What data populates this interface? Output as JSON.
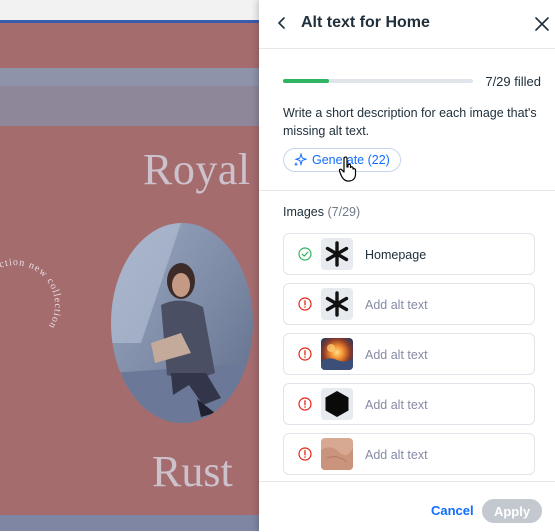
{
  "background": {
    "headline_top": "Royal",
    "headline_bottom": "Rust",
    "circle_text": "new collection new collection"
  },
  "panel": {
    "title": "Alt text for Home",
    "progress": {
      "filled": 7,
      "total": 29,
      "label": "7/29 filled"
    },
    "description": "Write a short description for each image that's missing alt text.",
    "generate_label": "Generate (22)",
    "images_heading": "Images",
    "images_count": "(7/29)",
    "images": [
      {
        "text": "Homepage",
        "status": "done",
        "thumb": "asterisk"
      },
      {
        "text": "Add alt text",
        "status": "missing",
        "thumb": "asterisk"
      },
      {
        "text": "Add alt text",
        "status": "missing",
        "thumb": "fiery-photo"
      },
      {
        "text": "Add alt text",
        "status": "missing",
        "thumb": "hexagon"
      },
      {
        "text": "Add alt text",
        "status": "missing",
        "thumb": "skin-photo"
      }
    ],
    "cancel_label": "Cancel",
    "apply_label": "Apply"
  },
  "colors": {
    "accent": "#116dff",
    "success": "#2fb461",
    "error": "#e62214",
    "disabled": "#c3c9cf"
  }
}
